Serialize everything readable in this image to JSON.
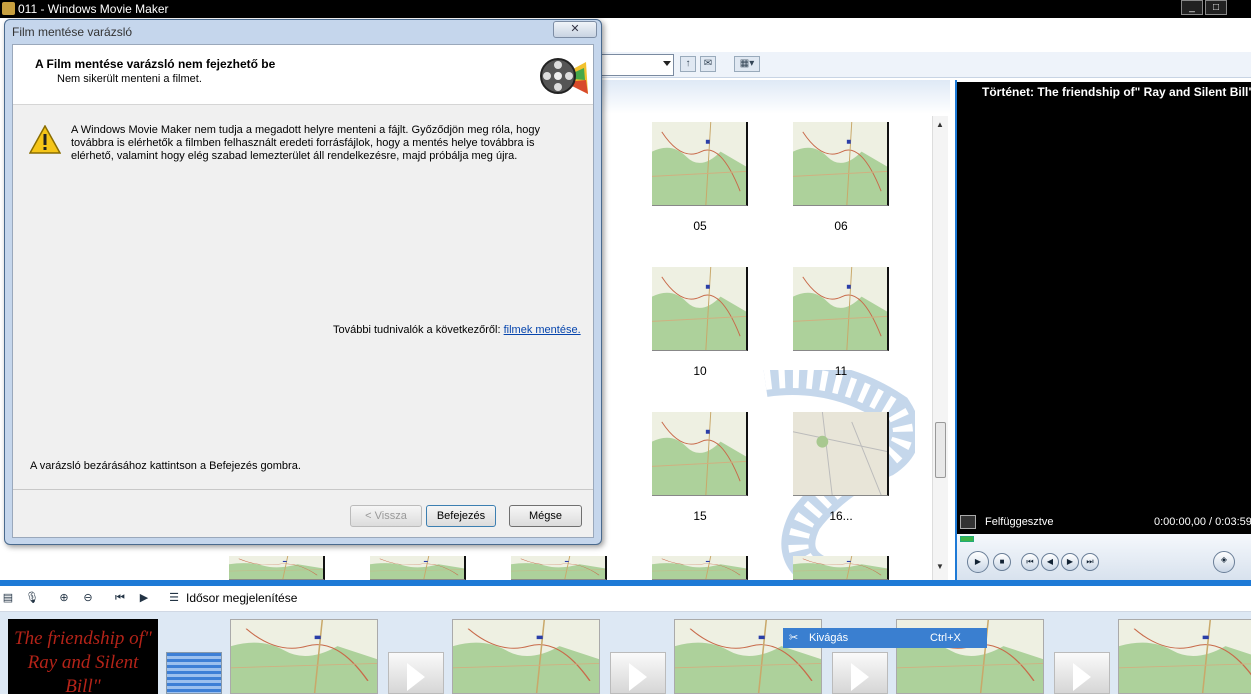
{
  "app": {
    "title": "011 - Windows Movie Maker"
  },
  "window_controls": {
    "minimize": "_",
    "maximize": "□"
  },
  "toolbar": {
    "view_icon": "▦▾"
  },
  "thumbnails": [
    {
      "label": "05"
    },
    {
      "label": "06"
    },
    {
      "label": "10"
    },
    {
      "label": "11"
    },
    {
      "label": "15"
    },
    {
      "label": "16..."
    }
  ],
  "preview": {
    "title": "Történet: The friendship of\" Ray and Silent Bill\"",
    "status": "Felfüggesztve",
    "time": "0:00:00,00 / 0:03:59"
  },
  "storyboard_toolbar": {
    "show_timeline": "Idősor megjelenítése"
  },
  "storyboard": {
    "title_clip": "The friendship of\" Ray and Silent Bill\""
  },
  "context_menu": {
    "item": "Kivágás",
    "shortcut": "Ctrl+X"
  },
  "dialog": {
    "title": "Film mentése varázsló",
    "close": "✕",
    "heading": "A Film mentése varázsló nem fejezhető be",
    "subheading": "Nem sikerült menteni a filmet.",
    "message": "A Windows Movie Maker nem tudja a megadott helyre menteni a fájlt. Győződjön meg róla, hogy továbbra is elérhetők a filmben felhasznált eredeti forrásfájlok, hogy a mentés helye továbbra is elérhető, valamint hogy elég szabad lemezterület áll rendelkezésre, majd próbálja meg újra.",
    "info_prefix": "További tudnivalók a következőről:",
    "info_link": "filmek mentése.",
    "hint": "A varázsló bezárásához kattintson a Befejezés gombra.",
    "buttons": {
      "back": "< Vissza",
      "finish": "Befejezés",
      "cancel": "Mégse"
    }
  }
}
